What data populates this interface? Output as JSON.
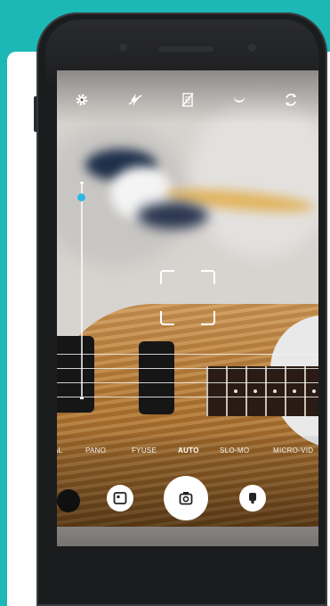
{
  "background": {
    "color": "#1cb8b6",
    "card": "#ffffff"
  },
  "top_bar": {
    "icons": [
      "gear-icon",
      "flash-off-icon",
      "hdr-off-icon",
      "night-mode-icon",
      "switch-camera-icon"
    ]
  },
  "zoom": {
    "level": 0.93
  },
  "modes": {
    "items": [
      "AL",
      "PANO",
      "FYUSE",
      "AUTO",
      "SLO-MO",
      "MICRO-VID"
    ],
    "selected": "AUTO"
  },
  "controls": {
    "left": "gallery-icon",
    "center": "shutter-camera-icon",
    "right": "video-record-icon"
  },
  "colors": {
    "accent": "#2fb7e4",
    "teal": "#1cb8b6"
  }
}
